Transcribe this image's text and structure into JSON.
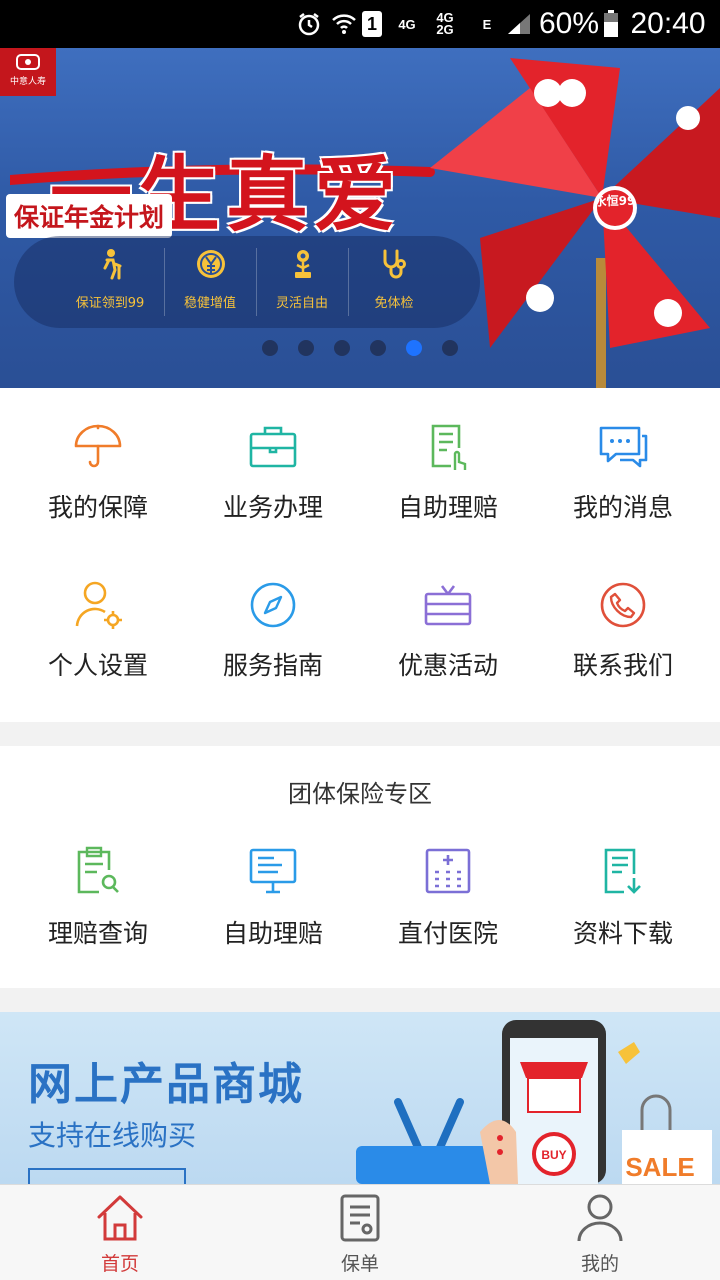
{
  "status_bar": {
    "network_4g": "4G",
    "network_stack_top": "4G",
    "network_stack_bottom": "2G",
    "network_e": "E",
    "sim_slot": "1",
    "battery": "60%",
    "time": "20:40"
  },
  "banner": {
    "logo_text": "中意人寿",
    "headline": "一生真爱",
    "subtitle": "保证年金计划",
    "badge": "永恒99",
    "features": [
      {
        "label": "保证领到99",
        "icon": "elderly-walking-icon"
      },
      {
        "label": "稳健增值",
        "icon": "yen-coin-icon"
      },
      {
        "label": "灵活自由",
        "icon": "flower-plant-icon"
      },
      {
        "label": "免体检",
        "icon": "stethoscope-icon"
      }
    ],
    "carousel_count": 6,
    "carousel_active_index": 4
  },
  "services": {
    "items": [
      {
        "label": "我的保障",
        "icon": "umbrella-icon",
        "color": "#f07c2a"
      },
      {
        "label": "业务办理",
        "icon": "briefcase-icon",
        "color": "#1fb5a3"
      },
      {
        "label": "自助理赔",
        "icon": "document-hand-icon",
        "color": "#5cb85c"
      },
      {
        "label": "我的消息",
        "icon": "chat-bubbles-icon",
        "color": "#2a8be8"
      },
      {
        "label": "个人设置",
        "icon": "user-gear-icon",
        "color": "#f5a623"
      },
      {
        "label": "服务指南",
        "icon": "compass-icon",
        "color": "#2a9be8"
      },
      {
        "label": "优惠活动",
        "icon": "gift-card-icon",
        "color": "#8b6fd6"
      },
      {
        "label": "联系我们",
        "icon": "phone-icon",
        "color": "#e0503a"
      }
    ]
  },
  "group_insurance": {
    "title": "团体保险专区",
    "items": [
      {
        "label": "理赔查询",
        "icon": "clipboard-search-icon",
        "color": "#5cb85c"
      },
      {
        "label": "自助理赔",
        "icon": "monitor-icon",
        "color": "#2a9be8"
      },
      {
        "label": "直付医院",
        "icon": "hospital-icon",
        "color": "#7b6fd6"
      },
      {
        "label": "资料下载",
        "icon": "document-download-icon",
        "color": "#1fb5a3"
      }
    ]
  },
  "promo": {
    "title": "网上产品商城",
    "subtitle": "支持在线购买",
    "buy_tag": "BUY",
    "sale_tag": "SALE"
  },
  "tab_bar": {
    "tabs": [
      {
        "label": "首页",
        "icon": "home-icon",
        "active": true
      },
      {
        "label": "保单",
        "icon": "policy-document-icon",
        "active": false
      },
      {
        "label": "我的",
        "icon": "person-icon",
        "active": false
      }
    ],
    "active_color": "#d23a3a"
  }
}
